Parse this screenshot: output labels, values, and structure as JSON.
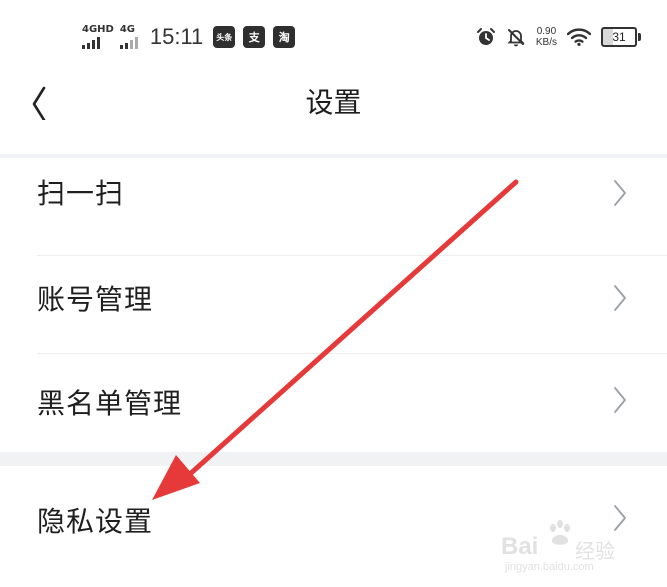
{
  "status_bar": {
    "network_1": "4GHD",
    "network_2": "4G",
    "time": "15:11",
    "app_icons": [
      "头条",
      "支",
      "淘"
    ],
    "speed_value": "0.90",
    "speed_unit": "KB/s",
    "battery": "31",
    "icons": [
      "alarm-icon",
      "mute-bell-icon",
      "wifi-icon",
      "battery-icon"
    ]
  },
  "nav": {
    "title": "设置",
    "back_icon": "chevron-left-icon"
  },
  "menu": {
    "items": [
      {
        "label": "扫一扫",
        "icon": "chevron-right-icon"
      },
      {
        "label": "账号管理",
        "icon": "chevron-right-icon"
      },
      {
        "label": "黑名单管理",
        "icon": "chevron-right-icon"
      },
      {
        "label": "隐私设置",
        "icon": "chevron-right-icon"
      }
    ]
  },
  "annotation": {
    "color": "#e63a3a",
    "icon": "red-arrow"
  },
  "watermark": {
    "brand": "Bai",
    "word": "经验",
    "url": "jingyan.baidu.com"
  },
  "colors": {
    "background": "#ffffff",
    "section_gap": "#f1f2f4",
    "text": "#1f1f1f",
    "chevron": "#9aa0a6"
  }
}
